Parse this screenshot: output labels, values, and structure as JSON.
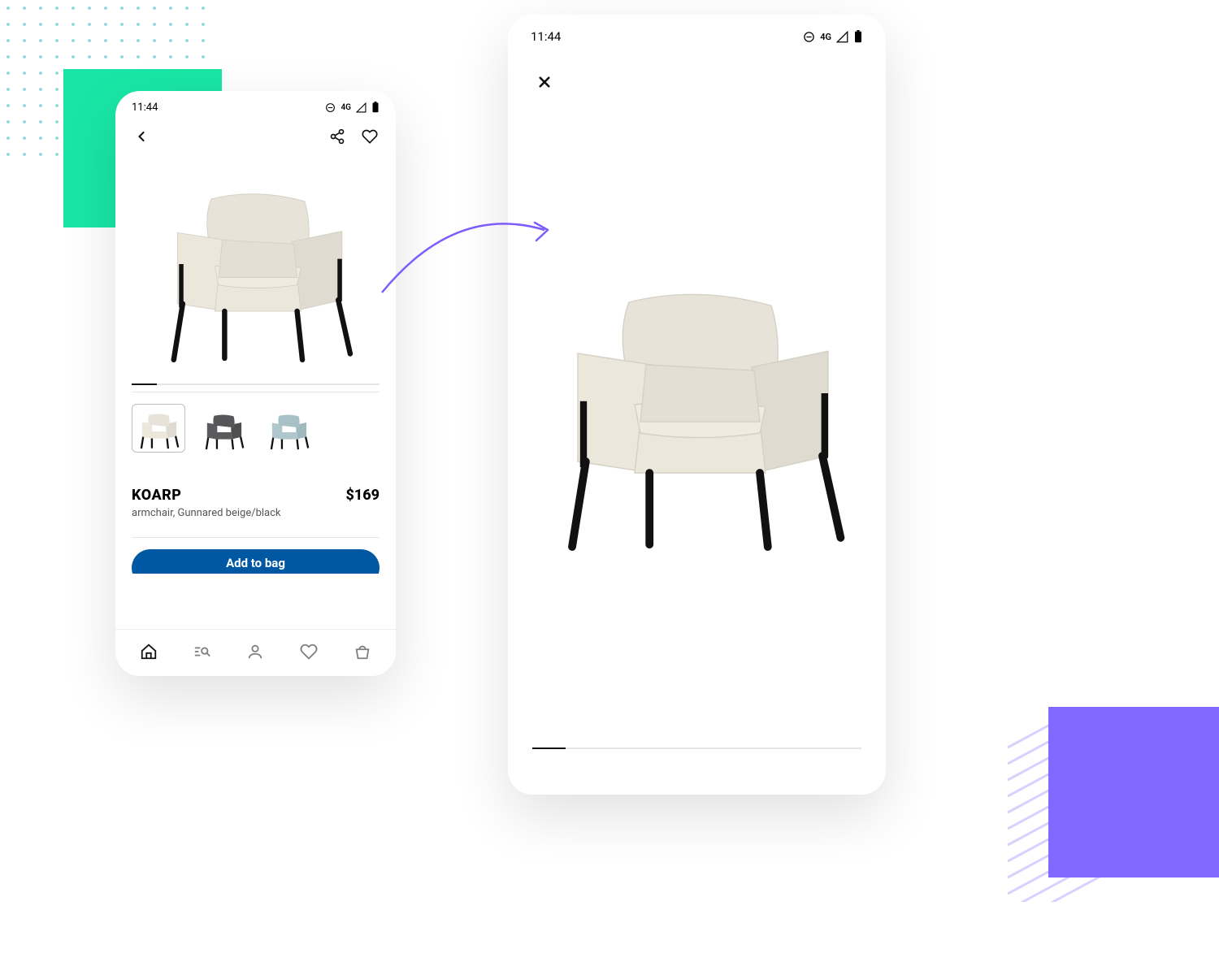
{
  "status": {
    "time": "11:44",
    "net": "4G"
  },
  "product": {
    "name": "KOARP",
    "price": "$169",
    "desc": "armchair, Gunnared beige/black",
    "cta": "Add to bag"
  },
  "variants": [
    {
      "label": "Gunnared beige",
      "fabric": "#e3ded4",
      "selected": true
    },
    {
      "label": "Gunnared grey",
      "fabric": "#5b5b5d",
      "selected": false
    },
    {
      "label": "Gunnared blue",
      "fabric": "#afc7cc",
      "selected": false
    }
  ],
  "colors": {
    "accent_green": "#19e6a6",
    "accent_purple": "#8169ff",
    "cta_blue": "#0058a3"
  },
  "nav": {
    "home": "Home",
    "search": "Search",
    "account": "Account",
    "favorites": "Favorites",
    "bag": "Bag"
  }
}
